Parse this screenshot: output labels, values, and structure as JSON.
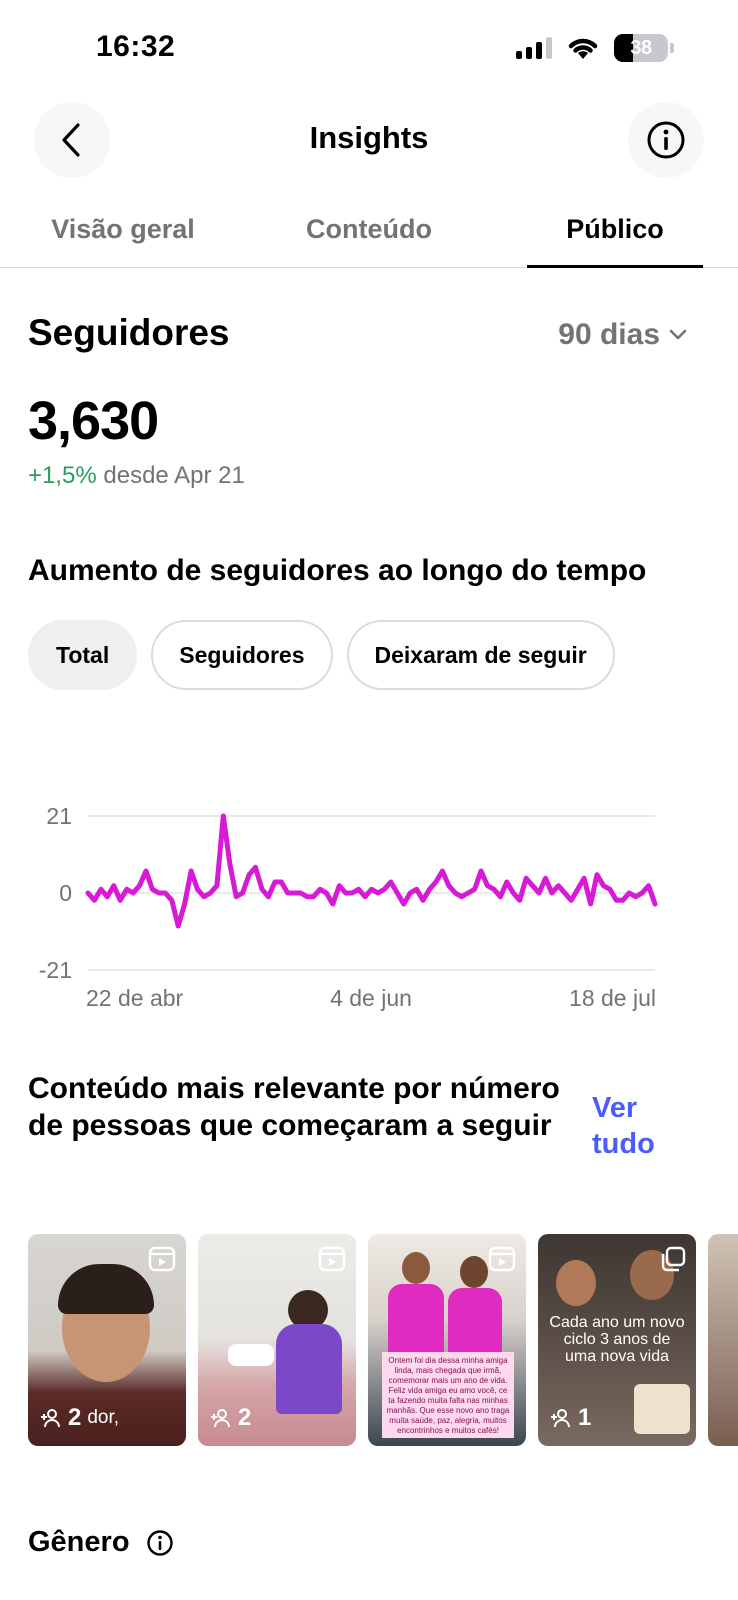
{
  "status_bar": {
    "time": "16:32",
    "battery": "38"
  },
  "header": {
    "title": "Insights"
  },
  "tabs": [
    {
      "label": "Visão geral"
    },
    {
      "label": "Conteúdo"
    },
    {
      "label": "Público"
    }
  ],
  "followers": {
    "title": "Seguidores",
    "range": "90 dias",
    "count": "3,630",
    "change": "+1,5%",
    "change_suffix": "desde Apr 21"
  },
  "growth": {
    "title": "Aumento de seguidores ao longo do tempo",
    "filters": [
      "Total",
      "Seguidores",
      "Deixaram de seguir"
    ],
    "active_filter": "Total"
  },
  "chart_data": {
    "type": "line",
    "ylim": [
      -21,
      21
    ],
    "yticks": [
      "21",
      "0",
      "-21"
    ],
    "xticks": [
      "22 de abr",
      "4 de jun",
      "18 de jul"
    ],
    "series": [
      {
        "color": "#d61ad6",
        "values": [
          0,
          -2,
          1,
          -1,
          2,
          -2,
          1,
          0,
          2,
          6,
          1,
          0,
          0,
          -2,
          -9,
          -3,
          6,
          1,
          -1,
          0,
          2,
          21,
          8,
          -1,
          0,
          5,
          7,
          1,
          -1,
          3,
          3,
          0,
          0,
          0,
          -1,
          -1,
          1,
          0,
          -3,
          2,
          0,
          0,
          1,
          -1,
          1,
          0,
          1,
          3,
          0,
          -3,
          0,
          1,
          -2,
          1,
          3,
          6,
          2,
          0,
          -1,
          0,
          1,
          6,
          2,
          1,
          -1,
          3,
          0,
          -2,
          4,
          2,
          0,
          4,
          0,
          2,
          0,
          -2,
          1,
          4,
          -3,
          5,
          2,
          1,
          -2,
          -2,
          0,
          -1,
          0,
          2,
          -3
        ]
      }
    ]
  },
  "top_content": {
    "title": "Conteúdo mais relevante por número de pessoas que começaram a seguir",
    "see_all": "Ver tudo",
    "items": [
      {
        "follows": "2",
        "extra": "dor,"
      },
      {
        "follows": "2",
        "extra": ""
      },
      {
        "follows": "",
        "extra": "",
        "caption": "Ontem foi dia dessa minha amiga linda, mais chegada que irmã, comemorar mais um ano de vida. Feliz vida amiga eu amo você, ce ta fazendo muita falta nas minhas manhãs. Que esse novo ano traga muita saúde, paz, alegria, muitos encontrinhos e muitos cafés!"
      },
      {
        "follows": "1",
        "extra": "",
        "overlay": "Cada ano um novo ciclo 3 anos de uma nova vida"
      }
    ]
  },
  "gender": {
    "title": "Gênero"
  },
  "colors": {
    "accent_link": "#4a5df9",
    "positive": "#2a9d5c",
    "line": "#d61ad6"
  }
}
